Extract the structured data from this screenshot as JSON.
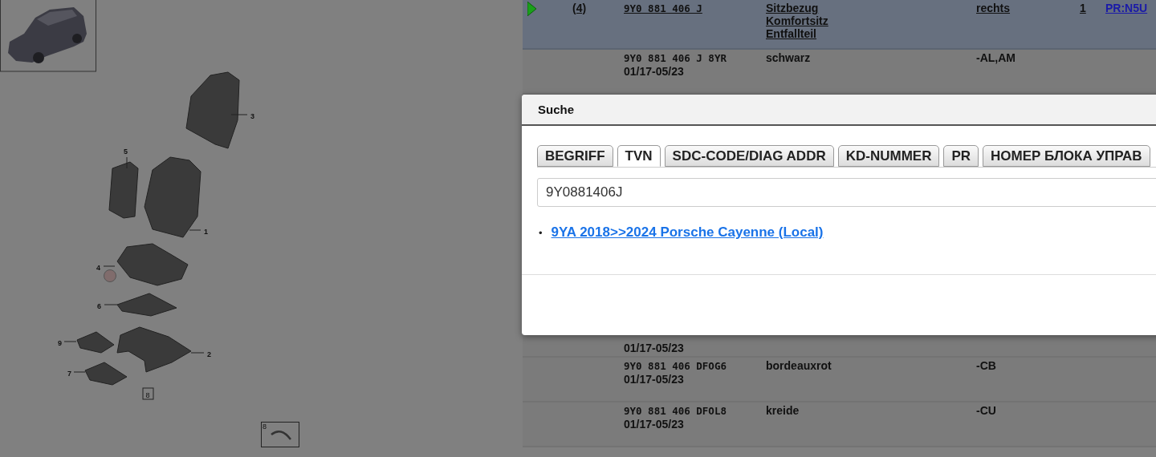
{
  "diagram": {
    "callouts": [
      {
        "label": "3"
      },
      {
        "label": "5"
      },
      {
        "label": "1"
      },
      {
        "label": "4"
      },
      {
        "label": "6"
      },
      {
        "label": "9"
      },
      {
        "label": "2"
      },
      {
        "label": "7"
      },
      {
        "label": "8"
      }
    ],
    "inset": {
      "label": "8"
    }
  },
  "table": {
    "rows": [
      {
        "selected": true,
        "reference": "(4)",
        "part_number": "9Y0 881 406 J",
        "description": "Sitzbezug Komfortsitz Entfallteil",
        "position": "rechts",
        "quantity": "1",
        "link": "PR:N5U"
      },
      {
        "selected": false,
        "part_number": "9Y0 881 406 J 8YR",
        "date": "01/17-05/23",
        "description": "schwarz",
        "codes": "-AL,AM"
      },
      {
        "selected": false,
        "kind": "covered",
        "date": "01/17-05/23"
      },
      {
        "selected": false,
        "part_number": "9Y0 881 406 DFOG6",
        "date": "01/17-05/23",
        "description": "bordeauxrot",
        "codes": "-CB"
      },
      {
        "selected": false,
        "part_number": "9Y0 881 406 DFOL8",
        "date": "01/17-05/23",
        "description": "kreide",
        "codes": "-CU"
      }
    ]
  },
  "dialog": {
    "title": "Suche",
    "tabs": [
      {
        "label": "BEGRIFF",
        "selected": false
      },
      {
        "label": "TVN",
        "selected": true
      },
      {
        "label": "SDC-CODE/DIAG ADDR",
        "selected": false
      },
      {
        "label": "KD-NUMMER",
        "selected": false
      },
      {
        "label": "PR",
        "selected": false
      },
      {
        "label": "НОМЕР БЛОКА УПРАВ",
        "selected": false
      }
    ],
    "search": {
      "value": "9Y0881406J"
    },
    "results": [
      {
        "bullet": "•",
        "text": "9YA 2018>>2024 Porsche Cayenne (Local)"
      }
    ]
  }
}
